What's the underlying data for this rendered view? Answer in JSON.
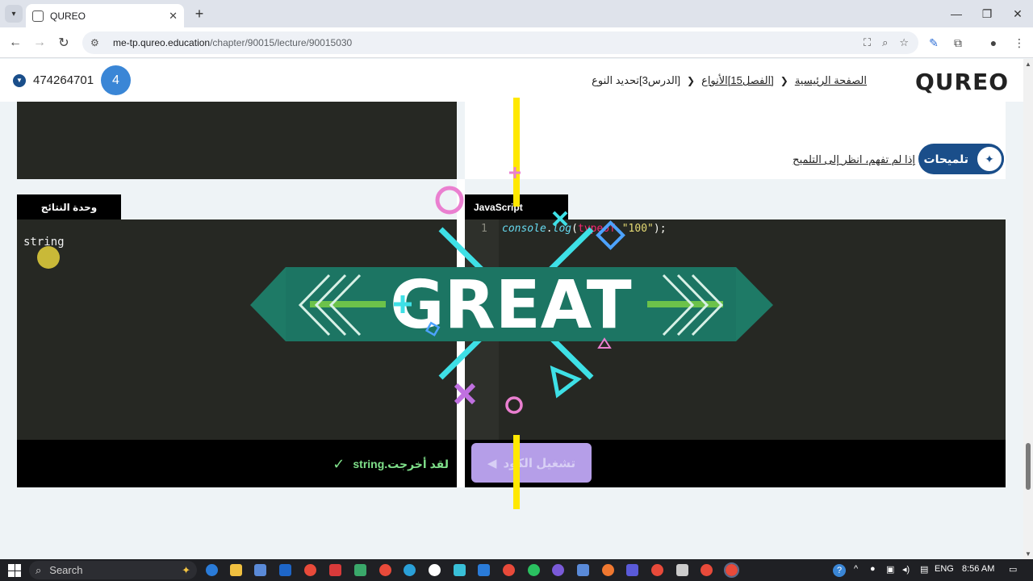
{
  "browser": {
    "tab_title": "QUREO",
    "url_host": "me-tp.qureo.education",
    "url_path": "/chapter/90015/lecture/90015030"
  },
  "header": {
    "logo": "QUREO",
    "breadcrumb": {
      "home": "الصفحة الرئيسية",
      "chapter": "[الفصل15]الأنواع",
      "lesson": "[الدرس3]تحديد النوع"
    },
    "user_id": "474264701",
    "level": "4"
  },
  "hints": {
    "badge_label": "تلميحات",
    "link_text": "إذا لم تفهم، انظر إلى التلميح"
  },
  "results": {
    "tab_label": "وحدة النتائج",
    "output": "string",
    "success_message": "لقد أخرجت.string"
  },
  "editor": {
    "tab_label": "JavaScript",
    "line_number": "1",
    "code": {
      "obj": "console",
      "dot": ".",
      "method": "log",
      "open": "(",
      "keyword": "typeof",
      "space": " ",
      "string": "\"100\"",
      "close": ");"
    },
    "run_button": "تشغيل الكود"
  },
  "overlay": {
    "text": "GREAT"
  },
  "taskbar": {
    "search_placeholder": "Search",
    "language": "ENG",
    "time": "8:56 AM"
  },
  "colors": {
    "banner": "#1e7a66",
    "banner_edge": "#17695a",
    "cyan": "#3ee0e6",
    "pink": "#ea7fd0",
    "yellow": "#ffe800",
    "green_bar": "#6cc24a",
    "run_button": "#b59ee8",
    "hint_blue": "#1a4e8a"
  }
}
